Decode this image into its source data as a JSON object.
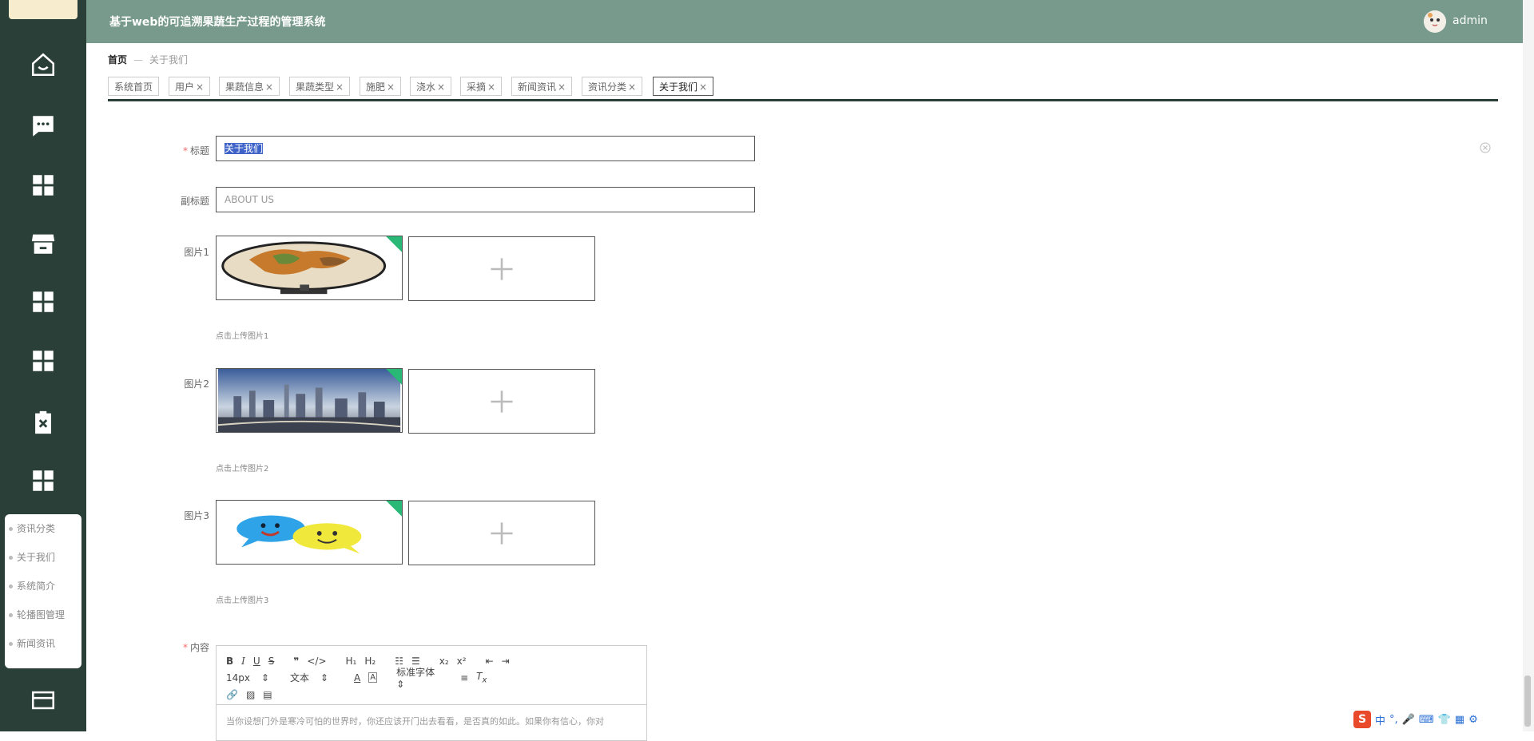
{
  "app": {
    "title": "基于web的可追溯果蔬生产过程的管理系统",
    "username": "admin"
  },
  "sidebar": {
    "icons": [
      "home-icon",
      "message-icon",
      "grid-icon",
      "store-icon",
      "grid-icon",
      "grid-icon",
      "clipboard-x-icon",
      "grid-icon",
      "wallet-icon"
    ],
    "submenu": [
      "资讯分类",
      "关于我们",
      "系统简介",
      "轮播图管理",
      "新闻资讯"
    ]
  },
  "breadcrumb": {
    "home": "首页",
    "current": "关于我们"
  },
  "tabs": [
    {
      "label": "系统首页",
      "closable": false
    },
    {
      "label": "用户",
      "closable": true
    },
    {
      "label": "果蔬信息",
      "closable": true
    },
    {
      "label": "果蔬类型",
      "closable": true
    },
    {
      "label": "施肥",
      "closable": true
    },
    {
      "label": "浇水",
      "closable": true
    },
    {
      "label": "采摘",
      "closable": true
    },
    {
      "label": "新闻资讯",
      "closable": true
    },
    {
      "label": "资讯分类",
      "closable": true
    },
    {
      "label": "关于我们",
      "closable": true,
      "active": true
    }
  ],
  "form": {
    "title_label": "标题",
    "title_value": "关于我们",
    "subtitle_label": "副标题",
    "subtitle_value": "ABOUT US",
    "pic1_label": "图片1",
    "pic1_tip": "点击上传图片1",
    "pic2_label": "图片2",
    "pic2_tip": "点击上传图片2",
    "pic3_label": "图片3",
    "pic3_tip": "点击上传图片3",
    "content_label": "内容"
  },
  "editor": {
    "size": "14px",
    "format": "文本",
    "font": "标准字体",
    "content": "当你设想门外是寒冷可怕的世界时，你还应该开门出去看看，是否真的如此。如果你有信心，你对"
  },
  "ime": {
    "label": "中"
  }
}
